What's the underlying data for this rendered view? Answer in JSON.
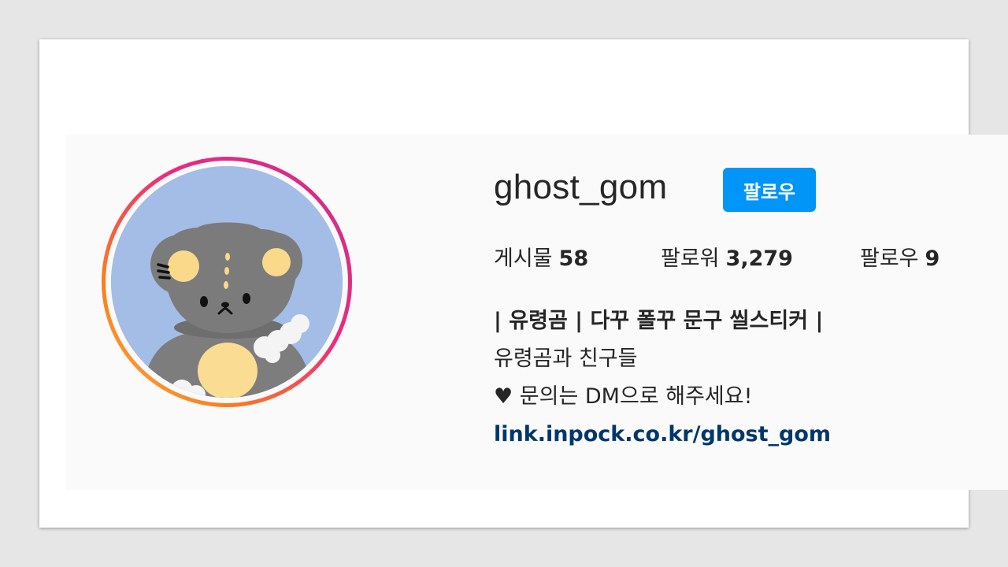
{
  "profile": {
    "username": "ghost_gom",
    "follow_button_label": "팔로우",
    "stats": {
      "posts_label": "게시물",
      "posts_count": "58",
      "followers_label": "팔로워",
      "followers_count": "3,279",
      "following_label": "팔로우",
      "following_count": "9"
    },
    "bio": {
      "name_line": "| 유령곰 | 다꾸 폴꾸 문구 씰스티커 |",
      "line1": "유령곰과 친구들",
      "line2": "♥ 문의는 DM으로 해주세요!",
      "link": "link.inpock.co.kr/ghost_gom"
    }
  },
  "colors": {
    "follow_button": "#0095f6",
    "link": "#00376b",
    "text": "#262626",
    "story_ring_start": "#fdb14a",
    "story_ring_end": "#c62f91",
    "avatar_background": "#a3bde6"
  },
  "icons": {
    "avatar": "bear-avatar-illustration"
  }
}
